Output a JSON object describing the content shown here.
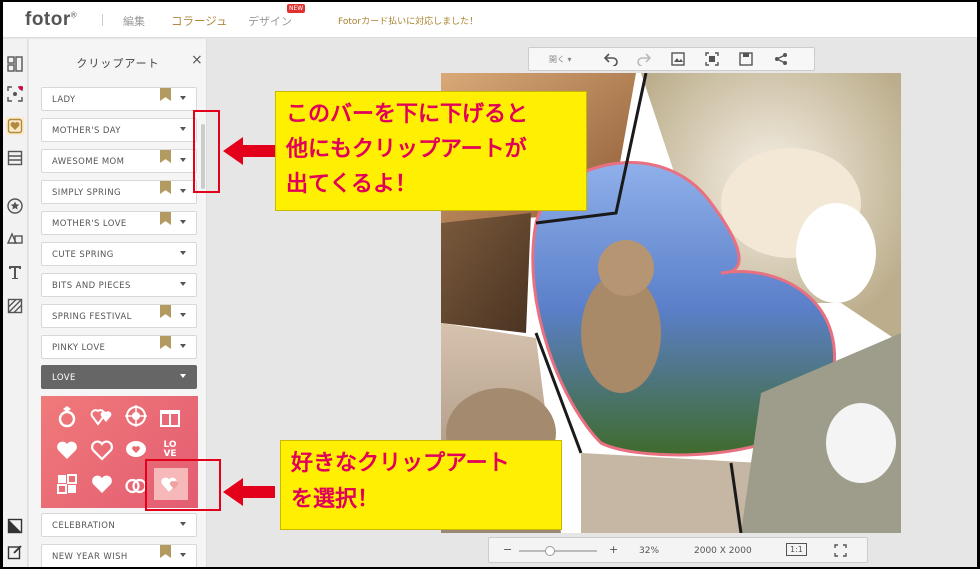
{
  "header": {
    "logo": "fotor",
    "logo_mark": "®",
    "nav": [
      "編集",
      "コラージュ",
      "デザイン"
    ],
    "new_badge": "NEW",
    "announcement": "Fotorカード払いに対応しました！"
  },
  "panel": {
    "title": "クリップアート",
    "close": "×",
    "categories": [
      {
        "label": "LADY",
        "bookmark": true
      },
      {
        "label": "MOTHER'S DAY",
        "bookmark": false
      },
      {
        "label": "AWESOME MOM",
        "bookmark": true
      },
      {
        "label": "SIMPLY SPRING",
        "bookmark": true
      },
      {
        "label": "MOTHER'S LOVE",
        "bookmark": true
      },
      {
        "label": "CUTE SPRING",
        "bookmark": false
      },
      {
        "label": "BITS AND PIECES",
        "bookmark": false
      },
      {
        "label": "SPRING FESTIVAL",
        "bookmark": true
      },
      {
        "label": "PINKY LOVE",
        "bookmark": true
      },
      {
        "label": "LOVE",
        "bookmark": false,
        "active": true
      },
      {
        "label": "CELEBRATION",
        "bookmark": false
      },
      {
        "label": "NEW YEAR WISH",
        "bookmark": true
      }
    ],
    "clipart_icons": [
      "ring-icon",
      "hearts-icon",
      "target-heart-icon",
      "gift-icon",
      "heart-icon",
      "heart-outline-icon",
      "speech-heart-icon",
      "love-text-icon",
      "love-badge-icon",
      "heart-solid-icon",
      "rings-icon",
      "double-heart-icon"
    ],
    "clipart_love_text": "LO VE"
  },
  "toolbar": {
    "open_label": "開く"
  },
  "zoombar": {
    "minus": "−",
    "plus": "+",
    "zoom": "32%",
    "size": "2000 X 2000",
    "ratio": "1:1"
  },
  "annotations": {
    "top": "このバーを下に下げると\n他にもクリップアートが\n出てくるよ！",
    "bottom": "好きなクリップアート\nを選択！"
  },
  "colors": {
    "accent": "#b08a3e",
    "annotation_bg": "#ffef00",
    "annotation_text": "#e1005a",
    "red": "#e2001a"
  }
}
